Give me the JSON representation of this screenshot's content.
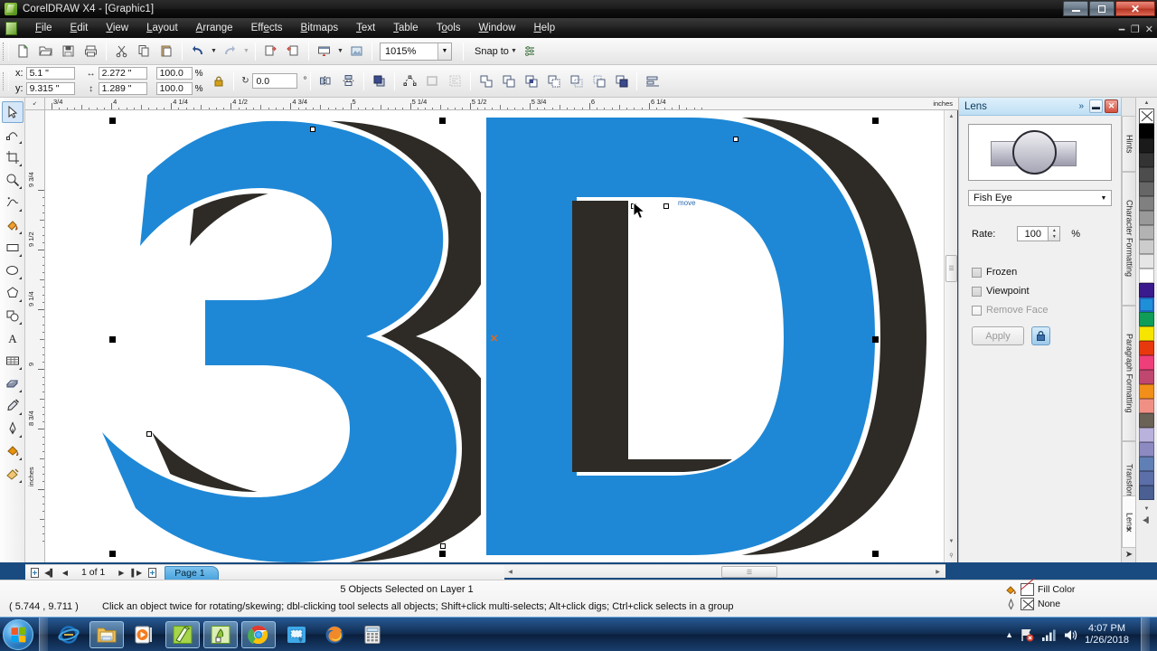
{
  "window": {
    "title": "CorelDRAW X4 - [Graphic1]",
    "app_icon": "coreldraw-icon",
    "buttons": {
      "minimize": "minimize",
      "restore": "restore",
      "close": "close"
    },
    "doc_buttons": {
      "minimize": "minimize",
      "restore": "restore",
      "close": "close"
    }
  },
  "menu": {
    "items": [
      {
        "label": "File",
        "accel": "F"
      },
      {
        "label": "Edit",
        "accel": "E"
      },
      {
        "label": "View",
        "accel": "V"
      },
      {
        "label": "Layout",
        "accel": "L"
      },
      {
        "label": "Arrange",
        "accel": "A"
      },
      {
        "label": "Effects",
        "accel": "E"
      },
      {
        "label": "Bitmaps",
        "accel": "B"
      },
      {
        "label": "Text",
        "accel": "T"
      },
      {
        "label": "Table",
        "accel": "T"
      },
      {
        "label": "Tools",
        "accel": "o"
      },
      {
        "label": "Window",
        "accel": "W"
      },
      {
        "label": "Help",
        "accel": "H"
      }
    ]
  },
  "standard_toolbar": {
    "buttons": [
      "new-document-icon",
      "open-document-icon",
      "save-icon",
      "print-icon",
      "cut-icon",
      "copy-icon",
      "paste-icon",
      "undo-icon",
      "redo-icon",
      "import-icon",
      "export-icon",
      "application-launcher-icon",
      "corel-online-icon"
    ],
    "zoom_level": "1015%",
    "snap_to_label": "Snap to",
    "options_icon": "options-icon"
  },
  "property_bar": {
    "x_label": "x:",
    "x_value": "5.1 \"",
    "y_label": "y:",
    "y_value": "9.315 \"",
    "width_value": "2.272 \"",
    "height_value": "1.289 \"",
    "scale_h": "100.0",
    "scale_v": "100.0",
    "percent": "%",
    "lock_ratio_icon": "lock-icon",
    "rotation_value": "0.0",
    "degree_symbol": "°",
    "mirror_h_icon": "mirror-horizontal-icon",
    "mirror_v_icon": "mirror-vertical-icon",
    "to_front_icon": "order-front-icon",
    "convert_to_curves_icon": "convert-to-curves-icon",
    "outline_icon": "outline-icon",
    "wrap_text_icon": "wrap-paragraph-text-icon",
    "shaping": [
      "weld-icon",
      "trim-icon",
      "intersect-icon",
      "simplify-icon",
      "front-minus-back-icon",
      "back-minus-front-icon",
      "create-boundary-icon"
    ],
    "align_icon": "align-and-distribute-icon"
  },
  "toolbox": {
    "tools": [
      {
        "name": "pick-tool",
        "glyph": "↖",
        "active": true
      },
      {
        "name": "shape-tool",
        "glyph": "↰",
        "active": false
      },
      {
        "name": "crop-tool",
        "glyph": "✂",
        "active": false
      },
      {
        "name": "zoom-tool",
        "glyph": "○",
        "active": false
      },
      {
        "name": "freehand-tool",
        "glyph": "∿",
        "active": false
      },
      {
        "name": "smart-fill-tool",
        "glyph": "◧",
        "active": false
      },
      {
        "name": "rectangle-tool",
        "glyph": "▭",
        "active": false
      },
      {
        "name": "ellipse-tool",
        "glyph": "○",
        "active": false
      },
      {
        "name": "polygon-tool",
        "glyph": "⬡",
        "active": false
      },
      {
        "name": "basic-shapes-tool",
        "glyph": "◔",
        "active": false
      },
      {
        "name": "text-tool",
        "glyph": "A",
        "active": false
      },
      {
        "name": "table-tool",
        "glyph": "▦",
        "active": false
      },
      {
        "name": "blend-tool",
        "glyph": "◰",
        "active": false
      },
      {
        "name": "eyedropper-tool",
        "glyph": "✒",
        "active": false
      },
      {
        "name": "outline-tool",
        "glyph": "✒",
        "active": false
      },
      {
        "name": "fill-tool",
        "glyph": "◢",
        "active": false
      },
      {
        "name": "interactive-fill-tool",
        "glyph": "◣",
        "active": false
      }
    ]
  },
  "rulers": {
    "unit": "inches",
    "horizontal_labels": [
      "3/4",
      "4",
      "4 1/4",
      "4 1/2",
      "4 3/4",
      "5",
      "5 1/4",
      "5 1/2",
      "5 3/4",
      "6",
      "6 1/4"
    ],
    "vertical_labels": [
      "9 3/4",
      "9 1/2",
      "9 1/4",
      "9",
      "8 3/4",
      "inches"
    ]
  },
  "canvas": {
    "artwork_text": "3D",
    "fill_color": "#1e88d6",
    "shadow_color": "#2e2b26",
    "background": "#ffffff"
  },
  "page_navigator": {
    "first_icon": "first-page-icon",
    "prev_icon": "previous-page-icon",
    "counter": "1 of 1",
    "next_icon": "next-page-icon",
    "last_icon": "last-page-icon",
    "add_page_icon": "add-page-icon",
    "page_tab": "Page 1"
  },
  "status_bar": {
    "objects_selected": "5 Objects Selected on Layer 1",
    "coordinates": "( 5.744 , 9.711 )",
    "hint": "Click an object twice for rotating/skewing; dbl-clicking tool selects all objects; Shift+click multi-selects; Alt+click digs; Ctrl+click selects in a group",
    "fill_label": "Fill Color",
    "outline_label": "None",
    "fill_icon": "fill-bucket-icon",
    "outline_icon": "outline-pen-icon"
  },
  "docker": {
    "title": "Lens",
    "collapse_icon": "chevron-double-right-icon",
    "minimize_icon": "minimize-icon",
    "close_icon": "close-icon",
    "preview_name": "lens-preview",
    "lens_type": "Fish Eye",
    "rate_label": "Rate:",
    "rate_value": "100",
    "rate_unit": "%",
    "frozen_label": "Frozen",
    "viewpoint_label": "Viewpoint",
    "remove_face_label": "Remove Face",
    "apply_label": "Apply",
    "lock_icon": "lock-icon",
    "tabs": [
      {
        "label": "Hints",
        "icon": "hints-icon",
        "active": false
      },
      {
        "label": "Character Formatting",
        "icon": "character-formatting-icon",
        "active": false
      },
      {
        "label": "Paragraph Formatting",
        "icon": "paragraph-formatting-icon",
        "active": false
      },
      {
        "label": "Transformation",
        "icon": "transformation-icon",
        "active": false
      },
      {
        "label": "Lens",
        "icon": "lens-icon",
        "active": true
      }
    ],
    "tab_close_icon": "close-icon"
  },
  "palette": {
    "scroll_up_icon": "scroll-up-icon",
    "scroll_down_icon": "scroll-down-icon",
    "expand_icon": "expand-palette-icon",
    "none_swatch": "no-color-swatch",
    "colors": [
      "#000000",
      "#1a1a1a",
      "#333333",
      "#4d4d4d",
      "#666666",
      "#808080",
      "#999999",
      "#b3b3b3",
      "#cccccc",
      "#e6e6e6",
      "#ffffff",
      "#3a1a8c",
      "#1e90d8",
      "#0f9d58",
      "#f6e500",
      "#e8380d",
      "#ef3f7a",
      "#c0476f",
      "#f18f1a",
      "#f09085",
      "#6b6257",
      "#b9b2dd",
      "#8d8ac2",
      "#5f7fb5",
      "#5d6fa8",
      "#4a5f92"
    ],
    "selected_color": "#1e90d8"
  },
  "taskbar": {
    "start_label": "start-orb",
    "items": [
      {
        "name": "internet-explorer",
        "icon": "ie-icon"
      },
      {
        "name": "windows-explorer",
        "icon": "folder-icon"
      },
      {
        "name": "media-player",
        "icon": "media-player-icon"
      },
      {
        "name": "coreldraw",
        "icon": "coreldraw-icon"
      },
      {
        "name": "corel-photo-paint",
        "icon": "photo-paint-icon"
      },
      {
        "name": "google-chrome",
        "icon": "chrome-icon"
      },
      {
        "name": "screen-capture",
        "icon": "capture-icon"
      },
      {
        "name": "mozilla-firefox",
        "icon": "firefox-icon"
      },
      {
        "name": "calculator",
        "icon": "calculator-icon"
      }
    ],
    "tray": {
      "show_hidden_icon": "chevron-up-icon",
      "network_icon": "network-error-icon",
      "signal_icon": "signal-icon",
      "volume_icon": "volume-icon",
      "time": "4:07 PM",
      "date": "1/26/2018"
    }
  }
}
